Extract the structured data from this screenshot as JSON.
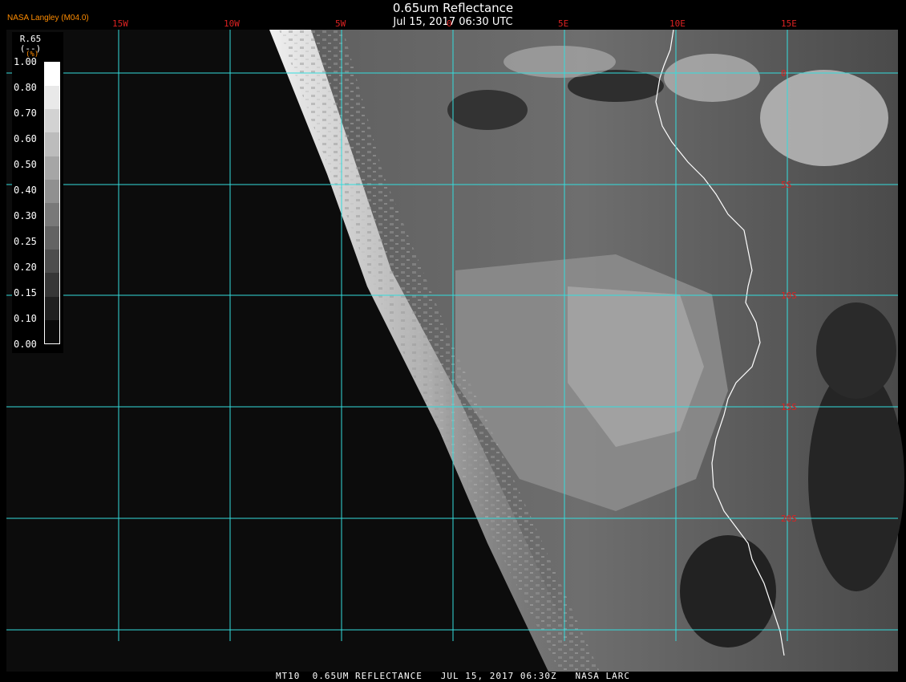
{
  "header": {
    "credit": "NASA Langley (M04.0)",
    "title": "0.65um Reflectance",
    "subtitle": "Jul 15, 2017 06:30 UTC"
  },
  "footer": {
    "text": "MT10  0.65UM REFLECTANCE   JUL 15, 2017 06:30Z   NASA LARC"
  },
  "legend": {
    "title": "R.65\n(--)",
    "unit": "(%)",
    "ticks": [
      "1.00",
      "0.80",
      "0.70",
      "0.60",
      "0.50",
      "0.40",
      "0.30",
      "0.25",
      "0.20",
      "0.15",
      "0.10",
      "0.00"
    ]
  },
  "grid": {
    "longitude_labels": [
      "15W",
      "10W",
      "5W",
      "0",
      "5E",
      "10E",
      "15E"
    ],
    "latitude_labels": [
      "0",
      "5S",
      "10S",
      "15S",
      "20S"
    ],
    "color": "#33dddd"
  },
  "colors": {
    "ocean_night": "#0c0c0c",
    "cloud_bright": "#e8e8e8",
    "coastline": "#ffffff",
    "labels": "#dd2222"
  }
}
